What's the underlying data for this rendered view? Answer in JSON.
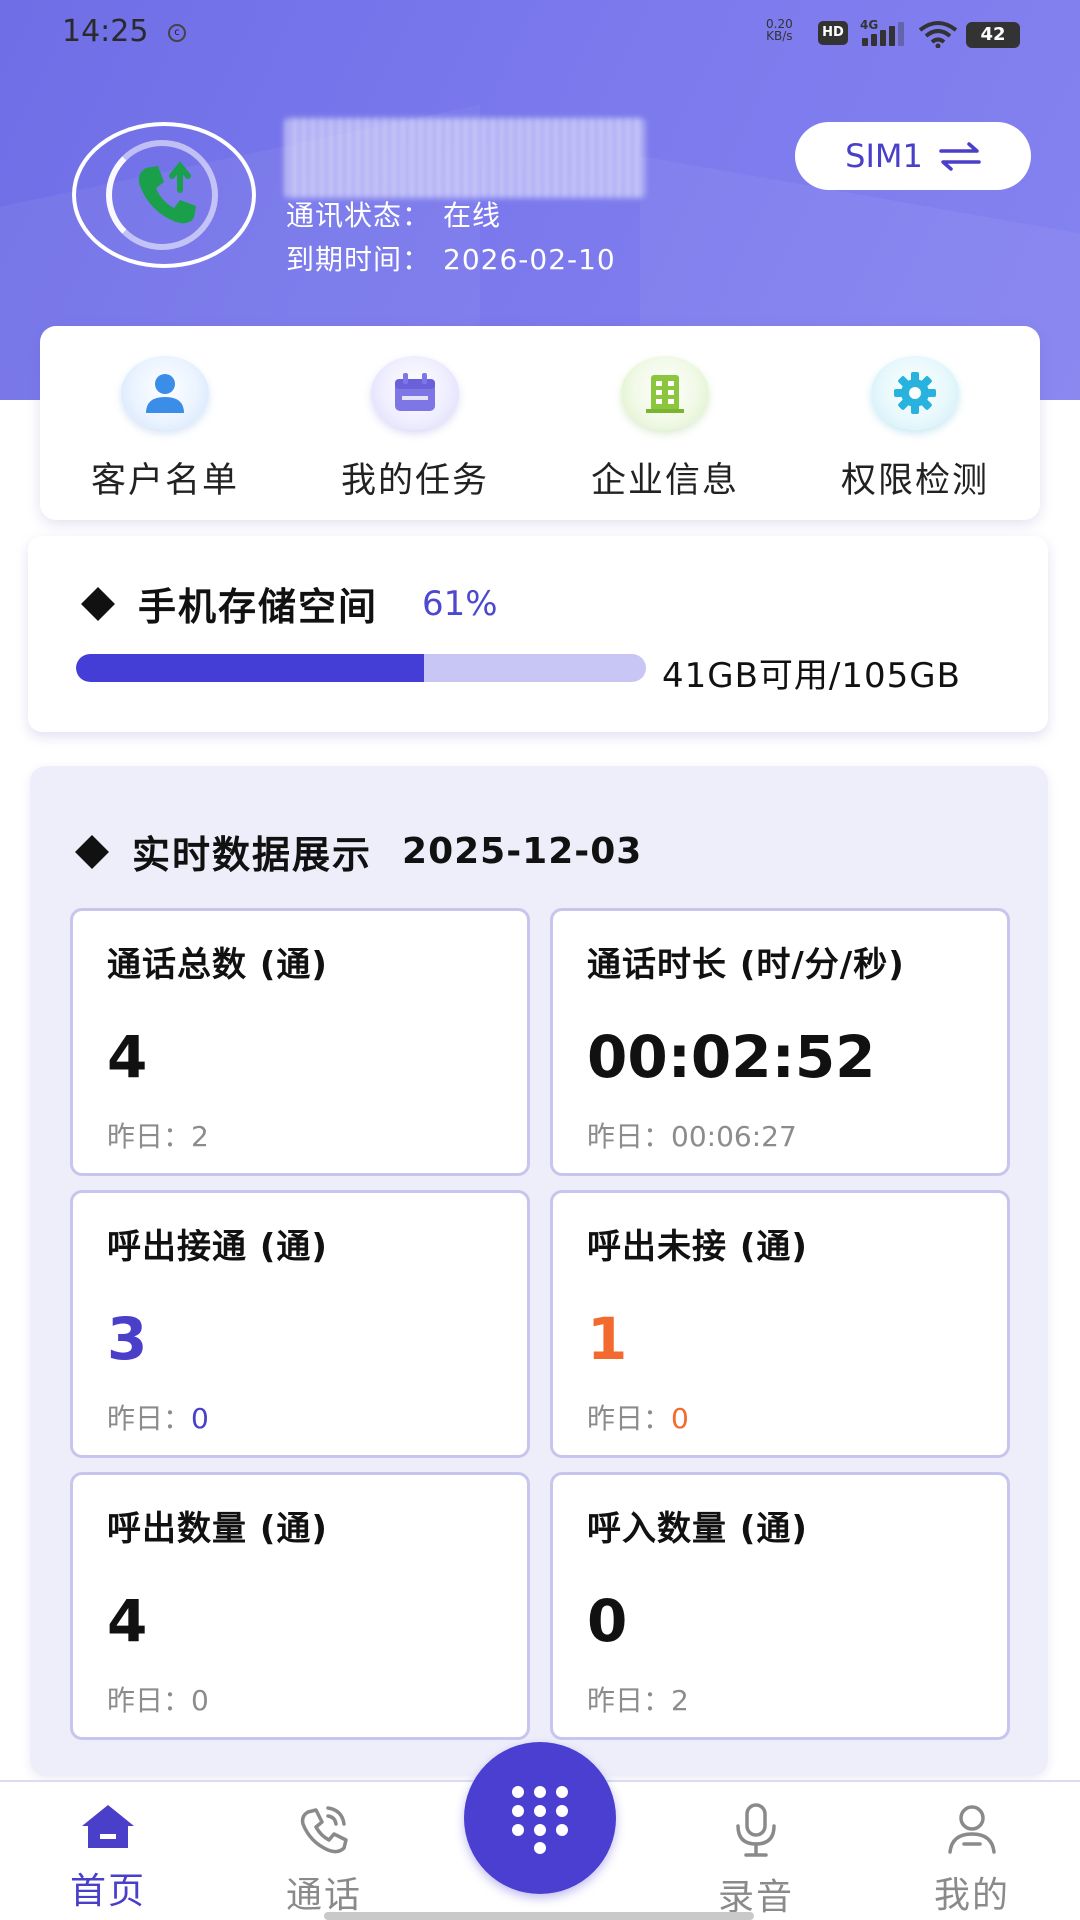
{
  "status_bar": {
    "time": "14:25",
    "net_speed_value": "0.20",
    "net_speed_unit": "KB/s",
    "hd": "HD",
    "network": "4G",
    "battery": "42"
  },
  "profile": {
    "status_label": "通讯状态：",
    "status_value": "在线",
    "expire_label": "到期时间：",
    "expire_value": "2026-02-10",
    "sim_label": "SIM1",
    "sim_swap_icon": "swap-arrows-icon"
  },
  "quick_menu": [
    {
      "label": "客户名单",
      "icon": "user-icon",
      "color": "#3a8ee8"
    },
    {
      "label": "我的任务",
      "icon": "calendar-icon",
      "color": "#7f76e6"
    },
    {
      "label": "企业信息",
      "icon": "building-icon",
      "color": "#8cc63f"
    },
    {
      "label": "权限检测",
      "icon": "gear-icon",
      "color": "#27b3dd"
    }
  ],
  "storage": {
    "title": "手机存储空间",
    "percent_text": "61%",
    "used_fraction": 0.61,
    "usage_text": "41GB可用/105GB"
  },
  "realtime": {
    "title": "实时数据展示",
    "date": "2025-12-03",
    "cards": [
      {
        "label": "通话总数 (通)",
        "value": "4",
        "prev_label": "昨日：",
        "prev_value": "2",
        "tone": "default"
      },
      {
        "label": "通话时长 (时/分/秒)",
        "value": "00:02:52",
        "prev_label": "昨日：",
        "prev_value": "00:06:27",
        "tone": "default"
      },
      {
        "label": "呼出接通 (通)",
        "value": "3",
        "prev_label": "昨日：",
        "prev_value": "0",
        "tone": "blue"
      },
      {
        "label": "呼出未接 (通)",
        "value": "1",
        "prev_label": "昨日：",
        "prev_value": "0",
        "tone": "orange"
      },
      {
        "label": "呼出数量 (通)",
        "value": "4",
        "prev_label": "昨日：",
        "prev_value": "0",
        "tone": "default"
      },
      {
        "label": "呼入数量 (通)",
        "value": "0",
        "prev_label": "昨日：",
        "prev_value": "2",
        "tone": "default"
      }
    ]
  },
  "bottom_nav": {
    "items": [
      {
        "label": "首页",
        "icon": "home-icon",
        "active": true
      },
      {
        "label": "通话",
        "icon": "phone-call-icon",
        "active": false
      },
      {
        "label": "录音",
        "icon": "microphone-icon",
        "active": false
      },
      {
        "label": "我的",
        "icon": "person-icon",
        "active": false
      }
    ],
    "dial_icon": "dialpad-icon"
  },
  "colors": {
    "accent": "#4a3fc9",
    "header_gradient_start": "#6f6ee6",
    "header_gradient_end": "#8583f0",
    "missed": "#f26a2e"
  }
}
